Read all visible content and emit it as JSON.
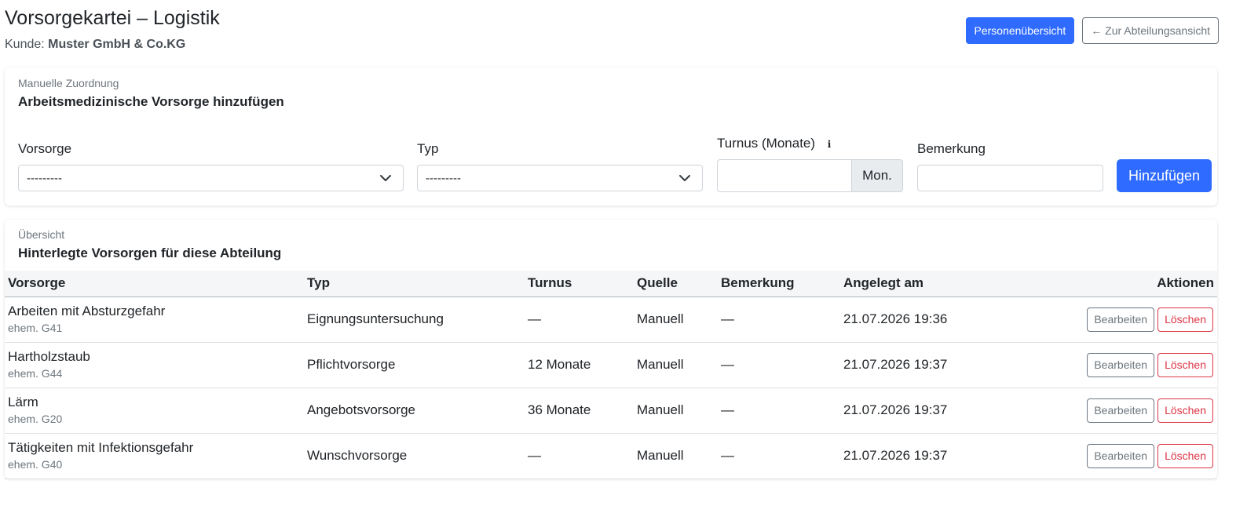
{
  "header": {
    "title": "Vorsorgekartei – Logistik",
    "customer_label": "Kunde:",
    "customer_name": "Muster GmbH & Co.KG",
    "persons_button": "Personenübersicht",
    "back_button": "← Zur Abteilungsansicht"
  },
  "add_card": {
    "eyebrow": "Manuelle Zuordnung",
    "heading": "Arbeitsmedizinische Vorsorge hinzufügen",
    "fields": {
      "vorsorge_label": "Vorsorge",
      "vorsorge_value": "---------",
      "typ_label": "Typ",
      "typ_value": "---------",
      "turnus_label": "Turnus (Monate)",
      "turnus_info": "i",
      "turnus_value": "",
      "turnus_addon": "Mon.",
      "bemerkung_label": "Bemerkung",
      "bemerkung_value": ""
    },
    "submit_button": "Hinzufügen"
  },
  "list_card": {
    "eyebrow": "Übersicht",
    "heading": "Hinterlegte Vorsorgen für diese Abteilung",
    "columns": [
      "Vorsorge",
      "Typ",
      "Turnus",
      "Quelle",
      "Bemerkung",
      "Angelegt am",
      "Aktionen"
    ],
    "rows": [
      {
        "vorsorge": "Arbeiten mit Absturzgefahr",
        "sub": "ehem. G41",
        "typ": "Eignungsuntersuchung",
        "turnus": "—",
        "quelle": "Manuell",
        "bemerkung": "—",
        "angelegt": "21.07.2026 19:36"
      },
      {
        "vorsorge": "Hartholzstaub",
        "sub": "ehem. G44",
        "typ": "Pflichtvorsorge",
        "turnus": "12 Monate",
        "quelle": "Manuell",
        "bemerkung": "—",
        "angelegt": "21.07.2026 19:37"
      },
      {
        "vorsorge": "Lärm",
        "sub": "ehem. G20",
        "typ": "Angebotsvorsorge",
        "turnus": "36 Monate",
        "quelle": "Manuell",
        "bemerkung": "—",
        "angelegt": "21.07.2026 19:37"
      },
      {
        "vorsorge": "Tätigkeiten mit Infektionsgefahr",
        "sub": "ehem. G40",
        "typ": "Wunschvorsorge",
        "turnus": "—",
        "quelle": "Manuell",
        "bemerkung": "—",
        "angelegt": "21.07.2026 19:37"
      }
    ],
    "edit_label": "Bearbeiten",
    "delete_label": "Löschen"
  },
  "colors": {
    "primary": "#2f6bff",
    "danger": "#dc3545",
    "secondary": "#6c757d"
  },
  "icons": {
    "select_chevron": "chevron-down-icon",
    "turnus_info": "info-icon"
  }
}
